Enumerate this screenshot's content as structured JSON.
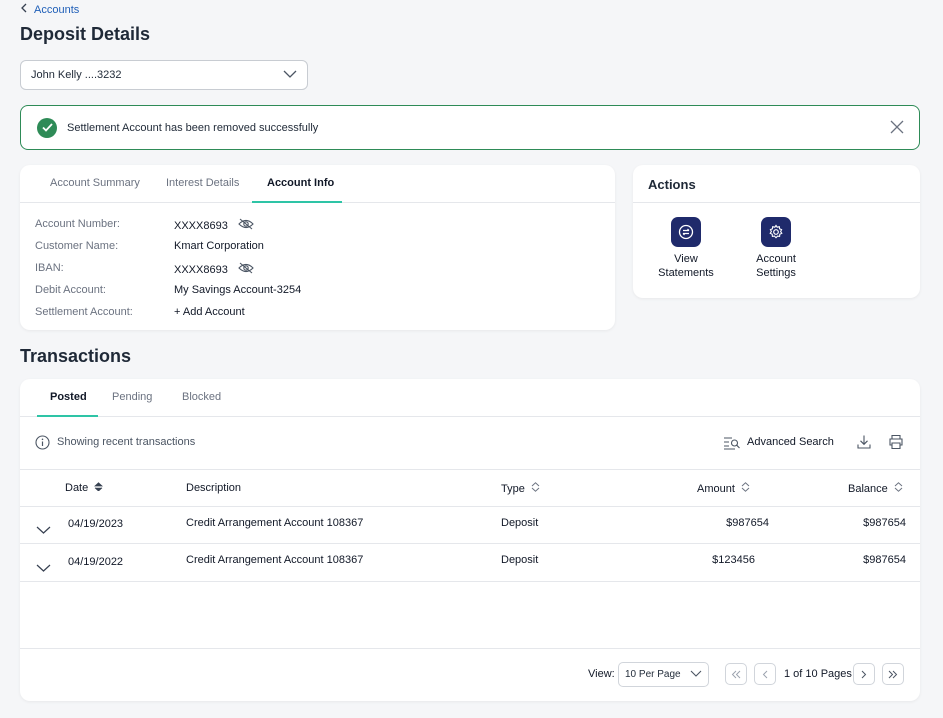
{
  "breadcrumb": {
    "back_label": "Accounts"
  },
  "page": {
    "title": "Deposit Details"
  },
  "account_selector": {
    "value": "John Kelly ....3232"
  },
  "alert": {
    "message": "Settlement Account has been removed successfully"
  },
  "account_card": {
    "tabs": [
      {
        "label": "Account Summary"
      },
      {
        "label": "Interest Details"
      },
      {
        "label": "Account Info"
      }
    ],
    "fields": [
      {
        "label": "Account Number:",
        "value": "XXXX8693"
      },
      {
        "label": "Customer Name:",
        "value": "Kmart Corporation"
      },
      {
        "label": "IBAN:",
        "value": "XXXX8693"
      },
      {
        "label": "Debit Account:",
        "value": "My Savings Account-3254"
      },
      {
        "label": "Settlement Account:",
        "value": "+ Add Account"
      }
    ]
  },
  "actions": {
    "title": "Actions",
    "items": [
      {
        "line1": "View",
        "line2": "Statements",
        "icon": "statements-icon"
      },
      {
        "line1": "Account",
        "line2": "Settings",
        "icon": "settings-icon"
      }
    ]
  },
  "transactions": {
    "title": "Transactions",
    "tabs": [
      {
        "label": "Posted"
      },
      {
        "label": "Pending"
      },
      {
        "label": "Blocked"
      }
    ],
    "info_text": "Showing recent transactions",
    "advanced_search": "Advanced Search",
    "columns": {
      "date": "Date",
      "description": "Description",
      "type": "Type",
      "amount": "Amount",
      "balance": "Balance"
    },
    "rows": [
      {
        "date": "04/19/2023",
        "description": "Credit Arrangement Account 108367",
        "type": "Deposit",
        "amount": "$987654",
        "balance": "$987654"
      },
      {
        "date": "04/19/2022",
        "description": "Credit Arrangement Account 108367",
        "type": "Deposit",
        "amount": "$123456",
        "balance": "$987654"
      }
    ],
    "pagination": {
      "view_label": "View:",
      "per_page": "10 Per Page",
      "page_info": "1 of 10 Pages"
    }
  },
  "colors": {
    "accent": "#2ec4a6",
    "primary_dark": "#1f2a6b",
    "success": "#2e8b57",
    "link": "#1f5fb8"
  }
}
